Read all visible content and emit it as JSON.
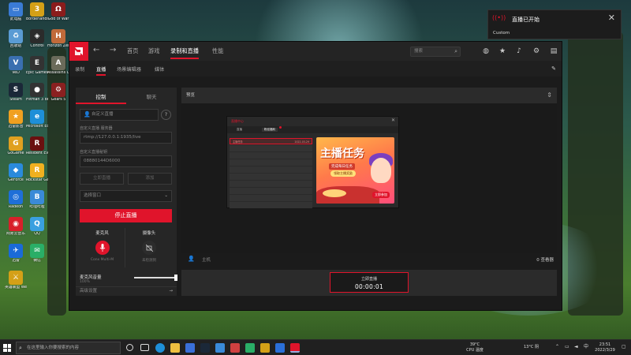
{
  "desktop": {
    "icons": [
      {
        "label": "此电脑",
        "color": "#3a7bd5",
        "glyph": "▭"
      },
      {
        "label": "Borderlands 3",
        "color": "#d4a017",
        "glyph": "3"
      },
      {
        "label": "God of War",
        "color": "#8a1c1c",
        "glyph": "Ω"
      },
      {
        "label": "回收站",
        "color": "#5a9bd4",
        "glyph": "♻"
      },
      {
        "label": "Control",
        "color": "#2b2b2b",
        "glyph": "◈"
      },
      {
        "label": "Horizon Zero Dawn",
        "color": "#c06a3a",
        "glyph": "H"
      },
      {
        "label": "VeD",
        "color": "#3a6fb0",
        "glyph": "V"
      },
      {
        "label": "Epic Games 启动程序",
        "color": "#333333",
        "glyph": "E"
      },
      {
        "label": "Assassins Creed",
        "color": "#6b6b5a",
        "glyph": "A"
      },
      {
        "label": "Steam",
        "color": "#1b2838",
        "glyph": "S"
      },
      {
        "label": "Hitman 3 Bridge",
        "color": "#333333",
        "glyph": "●"
      },
      {
        "label": "Gears 5",
        "color": "#8a2020",
        "glyph": "⚙"
      },
      {
        "label": "迅雷影音",
        "color": "#f0a020",
        "glyph": "★"
      },
      {
        "label": "Microsoft Edge",
        "color": "#1e8fd8",
        "glyph": "e"
      },
      {
        "label": "GoGame",
        "color": "#e0a020",
        "glyph": "G"
      },
      {
        "label": "Resident Evil",
        "color": "#6a1010",
        "glyph": "R"
      },
      {
        "label": "GeForce",
        "color": "#2a8adc",
        "glyph": "◆"
      },
      {
        "label": "Rockstar Games",
        "color": "#f0b020",
        "glyph": "R"
      },
      {
        "label": "Radeon",
        "color": "#1e6fd8",
        "glyph": "◎"
      },
      {
        "label": "哔哩哔哩",
        "color": "#3a8ad8",
        "glyph": "B"
      },
      {
        "label": "网易云音乐",
        "color": "#d8202a",
        "glyph": "◉"
      },
      {
        "label": "QQ",
        "color": "#3aa0e0",
        "glyph": "Q"
      },
      {
        "label": "迅雷",
        "color": "#1a6ad8",
        "glyph": "✈"
      },
      {
        "label": "微信",
        "color": "#2aae67",
        "glyph": "✉"
      },
      {
        "label": "英雄联盟 WeGame",
        "color": "#d4a017",
        "glyph": "⚔"
      }
    ]
  },
  "app": {
    "nav": {
      "back": "←",
      "forward": "→",
      "tabs": [
        "首页",
        "游戏",
        "录制和直播",
        "性能"
      ],
      "active_tab": "录制和直播",
      "search_placeholder": "搜索",
      "icons": [
        "globe-icon",
        "star-icon",
        "bell-icon",
        "gear-icon",
        "panel-icon"
      ]
    },
    "subtabs": [
      "录制",
      "直播",
      "场景编辑器",
      "媒体"
    ],
    "active_subtab": "直播",
    "left_panel": {
      "tabs": [
        "控制",
        "聊天"
      ],
      "active_tab": "控制",
      "custom_stream_placeholder": "自定义直播",
      "server_label": "自定义直播 服务器",
      "server_value": "rtmp://127.0.0.1:1935/live",
      "key_label": "自定义直播秘钥",
      "key_value": "08880144D6000",
      "btn_left": "立即直播",
      "btn_right": "添加",
      "select_window": "选择窗口",
      "stop_button": "停止直播",
      "mic_label": "麦克风",
      "mic_device": "Conx Multi-M",
      "cam_label": "摄像头",
      "cam_status": "未检测到",
      "volume_label": "麦克风音量",
      "volume_value": "100%",
      "volume_level": 1,
      "advanced": "高级设置"
    },
    "preview": {
      "title": "预览",
      "viewer_label": "主机",
      "viewer_count": "0 查看器",
      "timer_label": "立即直播",
      "timer_value": "00:00:01"
    },
    "mini": {
      "title": "直播中心",
      "tabs": [
        "直播",
        "粉丝福利"
      ],
      "active_tab": "粉丝福利",
      "rows": [
        {
          "label": "主播任务",
          "date": "2022-03-29",
          "selected": true
        },
        {
          "label": "",
          "date": ""
        },
        {
          "label": "",
          "date": ""
        },
        {
          "label": "",
          "date": ""
        },
        {
          "label": "",
          "date": ""
        },
        {
          "label": "",
          "date": ""
        },
        {
          "label": "",
          "date": ""
        },
        {
          "label": "",
          "date": ""
        },
        {
          "label": "",
          "date": ""
        },
        {
          "label": "",
          "date": ""
        }
      ],
      "banner": {
        "title": "主播任务",
        "subtitle": "完成每日任务",
        "tag": "领取主播奖励",
        "button": "立即参加"
      }
    }
  },
  "notification": {
    "title": "直播已开始",
    "subtitle": "Custom",
    "close": "✕"
  },
  "taskbar": {
    "search_placeholder": "在这里输入你要搜索的内容",
    "weather": "13°C 阴",
    "cpu_temp": "39°C",
    "cpu_label": "CPU 温度",
    "time": "23:51",
    "date": "2022/3/29",
    "tray_icons": [
      "chevron-up-icon",
      "network-icon",
      "volume-icon",
      "ime-icon",
      "notification-icon"
    ]
  }
}
